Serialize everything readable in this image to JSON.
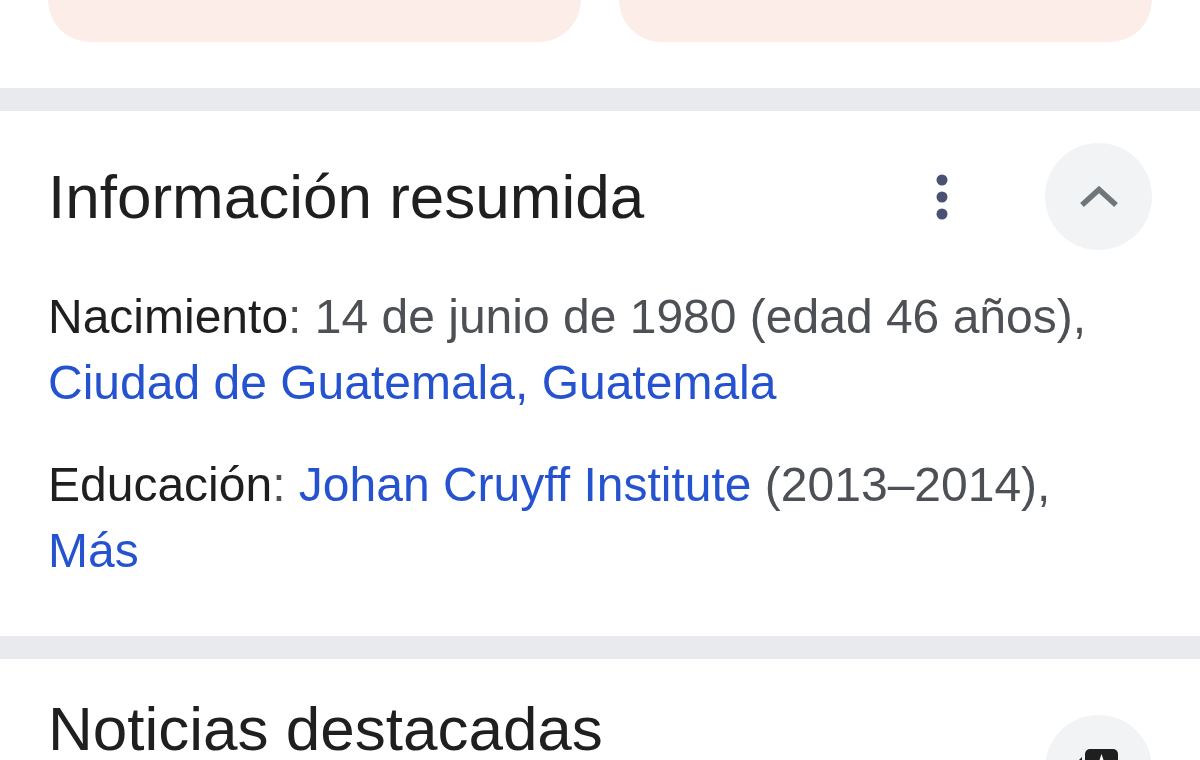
{
  "summary": {
    "title": "Información resumida",
    "expanded": true,
    "facts": [
      {
        "label": "Nacimiento",
        "parts": [
          {
            "kind": "text",
            "text": ": 14 de junio de 1980 (edad 46 años), "
          },
          {
            "kind": "link",
            "text": "Ciudad de Guatemala, Guatemala"
          }
        ]
      },
      {
        "label": "Educación",
        "parts": [
          {
            "kind": "text",
            "text": ": "
          },
          {
            "kind": "link",
            "text": "Johan Cruyff Institute"
          },
          {
            "kind": "text",
            "text": " (2013–2014), "
          },
          {
            "kind": "link",
            "text": "Más"
          }
        ]
      }
    ]
  },
  "news": {
    "title": "Noticias destacadas"
  }
}
